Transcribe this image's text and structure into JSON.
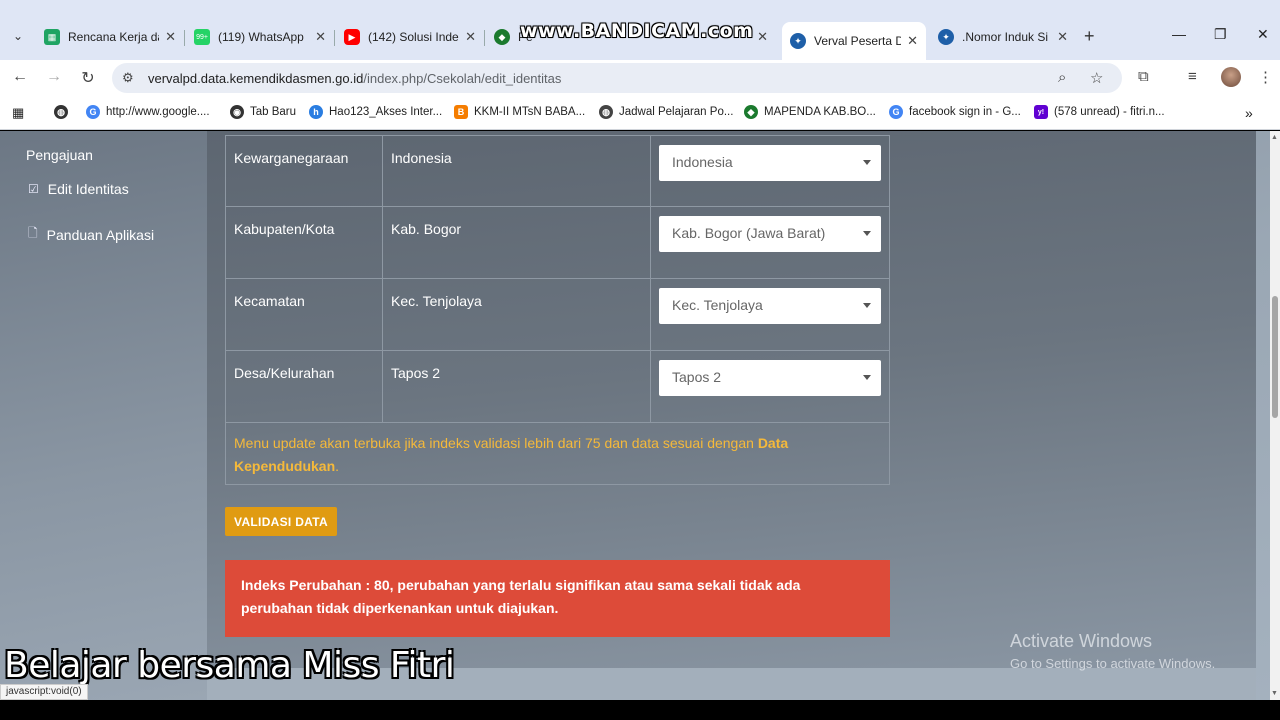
{
  "watermark": {
    "bandicam": "www.BANDICAM.com",
    "caption": "Belajar bersama Miss Fitri"
  },
  "tabs": [
    {
      "title": "Rencana Kerja da",
      "icon": "sheets-icon",
      "color": "#1fa463"
    },
    {
      "title": "(119) WhatsApp",
      "icon": "whatsapp-icon",
      "color": "#25d366",
      "badge": "99+"
    },
    {
      "title": "(142) Solusi Inde",
      "icon": "youtube-icon",
      "color": "#ff0000"
    },
    {
      "title": "Pe",
      "icon": "kemenag-icon",
      "color": "#1b7a2e"
    },
    {
      "title": "Verval Peserta D",
      "icon": "kemendikbud-icon",
      "color": "#1e5fa8",
      "active": true
    },
    {
      "title": ".Nomor Induk Si",
      "icon": "kemendikbud-icon",
      "color": "#1e5fa8"
    }
  ],
  "toolbar": {
    "url_host": "vervalpd.data.kemendikdasmen.go.id",
    "url_path": "/index.php/Csekolah/edit_identitas"
  },
  "bookmarks": [
    {
      "label": "http://www.google....",
      "icon": "google-icon",
      "color": "#4285f4",
      "glyph": "G"
    },
    {
      "label": "Tab Baru",
      "icon": "chrome-icon",
      "color": "#333333",
      "glyph": "◉"
    },
    {
      "label": "Hao123_Akses Inter...",
      "icon": "hao123-icon",
      "color": "#2a7de1",
      "glyph": "h"
    },
    {
      "label": "KKM-II MTsN BABA...",
      "icon": "blogger-icon",
      "color": "#f57d00",
      "glyph": "B"
    },
    {
      "label": "Jadwal Pelajaran Po...",
      "icon": "globe-icon",
      "color": "#444444",
      "glyph": "◍"
    },
    {
      "label": "MAPENDA KAB.BO...",
      "icon": "kemenag-icon",
      "color": "#1b7a2e",
      "glyph": "◆"
    },
    {
      "label": "facebook sign in - G...",
      "icon": "google-icon",
      "color": "#4285f4",
      "glyph": "G"
    },
    {
      "label": "(578 unread) - fitri.n...",
      "icon": "yahoo-icon",
      "color": "#6001d2",
      "glyph": "y!"
    }
  ],
  "sidebar": {
    "heading": "Pengajuan",
    "items": [
      {
        "label": "Edit Identitas",
        "icon": "edit-icon"
      },
      {
        "label": "Panduan Aplikasi",
        "icon": "document-icon"
      }
    ]
  },
  "table": {
    "rows": [
      {
        "field": "Kewarganegaraan",
        "current": "Indonesia",
        "selected": "Indonesia"
      },
      {
        "field": "Kabupaten/Kota",
        "current": "Kab. Bogor",
        "selected": "Kab. Bogor (Jawa Barat)"
      },
      {
        "field": "Kecamatan",
        "current": "Kec. Tenjolaya",
        "selected": "Kec. Tenjolaya"
      },
      {
        "field": "Desa/Kelurahan",
        "current": "Tapos 2",
        "selected": "Tapos 2"
      }
    ],
    "note_text": "Menu update akan terbuka jika indeks validasi lebih dari 75 dan data sesuai dengan ",
    "note_bold": "Data Kependudukan",
    "note_end": "."
  },
  "validasi_button": "VALIDASI DATA",
  "alert": "Indeks Perubahan : 80, perubahan yang terlalu signifikan atau sama sekali tidak ada perubahan tidak diperkenankan untuk diajukan.",
  "windows": {
    "activate_title": "Activate Windows",
    "activate_sub": "Go to Settings to activate Windows."
  },
  "statusbar": "javascript:void(0)"
}
